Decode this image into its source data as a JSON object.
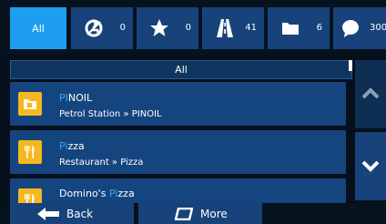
{
  "filter_tabs": [
    {
      "label": "All",
      "active": true
    },
    {
      "icon": "disabled-access-icon",
      "count": "0"
    },
    {
      "icon": "star-icon",
      "count": "0"
    },
    {
      "icon": "road-icon",
      "count": "41"
    },
    {
      "icon": "folder-icon",
      "count": "6"
    },
    {
      "icon": "speech-bubble-icon",
      "count": "300"
    }
  ],
  "list": {
    "header": "All",
    "items": [
      {
        "name_highlight": "PI",
        "name_rest": "NOIL",
        "name_prefix": "",
        "subtitle": "Petrol Station » PINOIL",
        "icon": "petrol-station-icon"
      },
      {
        "name_highlight": "Pi",
        "name_rest": "zza",
        "name_prefix": "",
        "subtitle": "Restaurant » Pizza",
        "icon": "restaurant-icon"
      },
      {
        "name_prefix": "Domino's ",
        "name_highlight": "Pi",
        "name_rest": "zza",
        "subtitle": "",
        "icon": "restaurant-icon"
      }
    ]
  },
  "scroll": {
    "up_icon": "chevron-up-icon",
    "down_icon": "chevron-down-icon"
  },
  "bottom": {
    "back_label": "Back",
    "more_label": "More"
  },
  "colors": {
    "accent": "#1e9ef0",
    "row_bg": "#15457e",
    "highlight_text": "#3aa8ee",
    "badge": "#f4b820"
  }
}
